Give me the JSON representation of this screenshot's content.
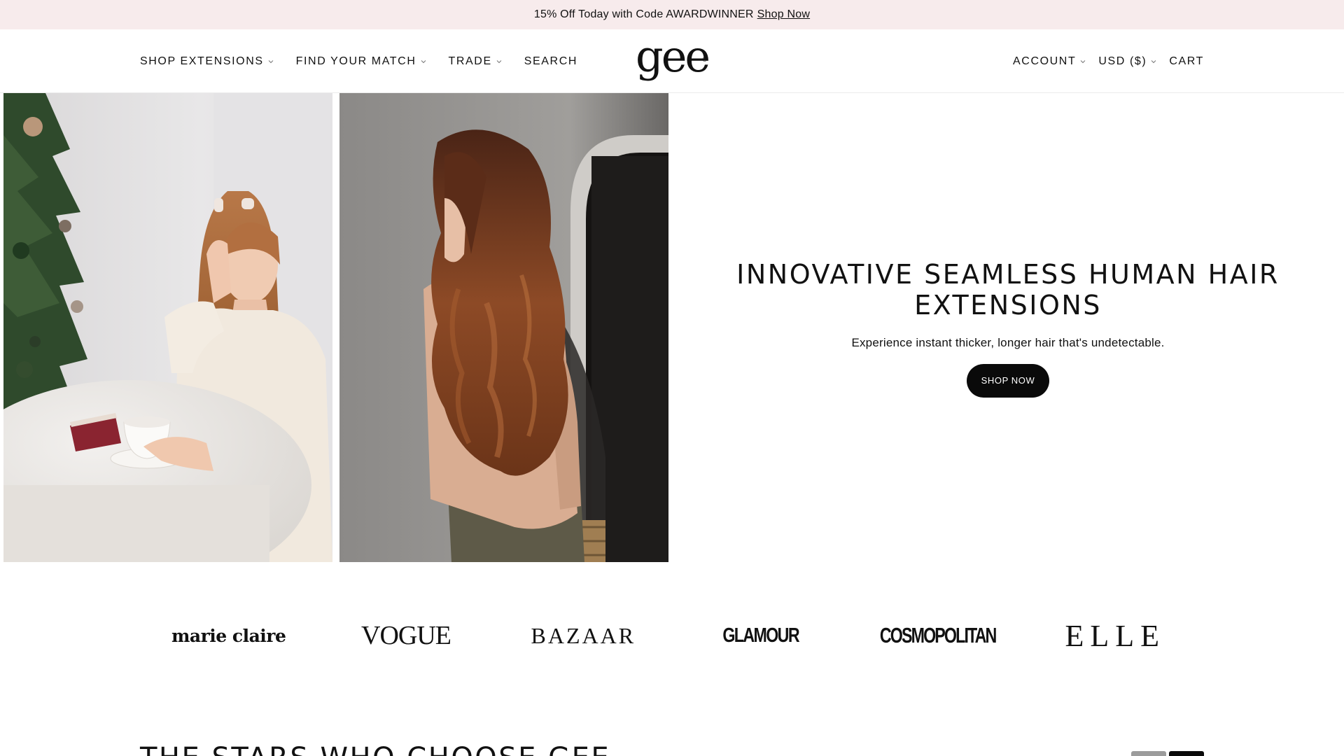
{
  "announcement": {
    "text": "15% Off Today with Code AWARDWINNER",
    "link": "Shop Now"
  },
  "header": {
    "nav_left": [
      {
        "label": "SHOP EXTENSIONS",
        "dropdown": true
      },
      {
        "label": "FIND YOUR MATCH",
        "dropdown": true
      },
      {
        "label": "TRADE",
        "dropdown": true
      },
      {
        "label": "SEARCH",
        "dropdown": false
      }
    ],
    "logo": "gee",
    "logo_mark": "®",
    "nav_right": [
      {
        "label": "ACCOUNT",
        "dropdown": true
      },
      {
        "label": "USD ($)",
        "dropdown": true
      },
      {
        "label": "CART",
        "dropdown": false
      }
    ]
  },
  "hero": {
    "title": "INNOVATIVE SEAMLESS HUMAN HAIR EXTENSIONS",
    "subtitle": "Experience instant thicker, longer hair that's undetectable.",
    "cta": "SHOP NOW"
  },
  "press": [
    "marie claire",
    "VOGUE",
    "BAZAAR",
    "GLAMOUR",
    "COSMOPOLITAN",
    "ELLE"
  ],
  "stars": {
    "heading": "THE STARS WHO CHOOSE GEE"
  },
  "colors": {
    "announcement_bg": "#f7ebec",
    "button_bg": "#0a0a0a",
    "text": "#111111"
  },
  "icons": [
    "chevron-down-icon",
    "logo-mark"
  ]
}
